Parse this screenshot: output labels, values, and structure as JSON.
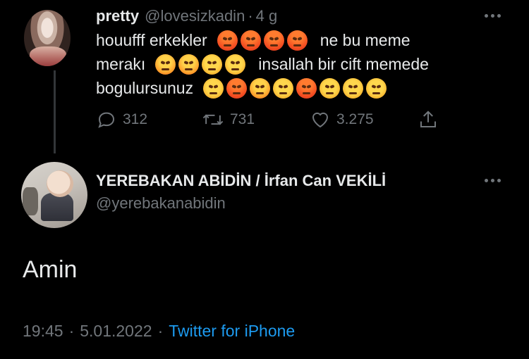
{
  "tweet1": {
    "display_name": "pretty",
    "handle": "@lovesizkadin",
    "separator": "·",
    "time": "4 g",
    "line1_text_a": "houufff erkekler",
    "line1_text_b": "ne bu meme",
    "line2_text_a": "merakı",
    "line2_text_b": "insallah bir cift memede",
    "line3_text_a": "bogulursunuz",
    "line1_emojis": [
      "angry-face-icon",
      "angry-face-icon",
      "angry-face-icon",
      "angry-face-icon"
    ],
    "line2_emojis": [
      "angry-face-icon",
      "angry-face-icon",
      "steam-face-icon",
      "steam-face-icon"
    ],
    "line3_emojis": [
      "steam-face-icon",
      "angry-face-icon",
      "angry-face-icon",
      "steam-face-icon",
      "angry-face-icon",
      "steam-face-icon",
      "steam-face-icon",
      "steam-face-icon"
    ],
    "replies": "312",
    "retweets": "731",
    "likes": "3.275"
  },
  "tweet2": {
    "display_name": "YEREBAKAN ABİDİN / İrfan Can VEKİLİ",
    "handle": "@yerebakanabidin",
    "body": "Amin",
    "time": "19:45",
    "date": "5.01.2022",
    "separator": "·",
    "source": "Twitter for iPhone"
  },
  "colors": {
    "background": "#000000",
    "text": "#e7e9ea",
    "muted": "#71767b",
    "link": "#1d9bf0",
    "thread_line": "#333639"
  }
}
